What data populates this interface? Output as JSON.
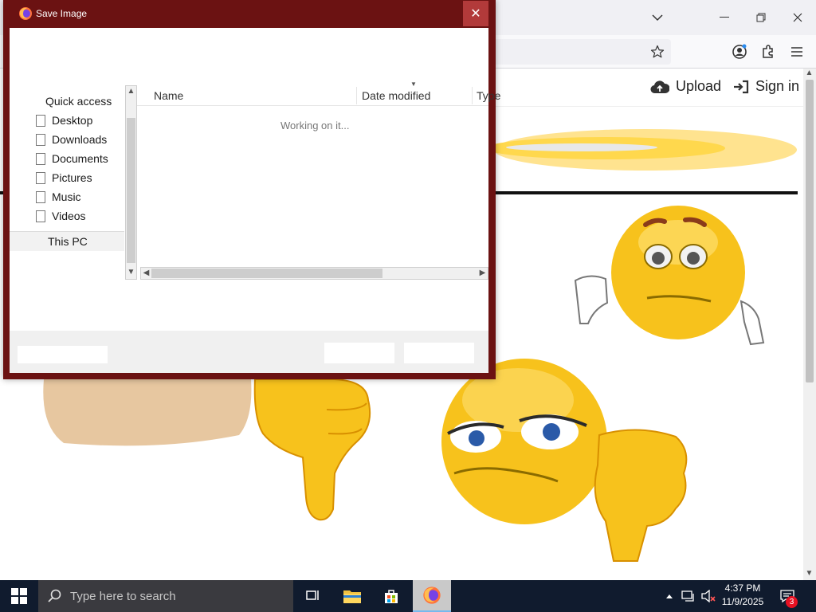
{
  "dialog": {
    "title": "Save Image",
    "close_glyph": "✕",
    "nav": {
      "quick_access": "Quick access",
      "items": [
        "Desktop",
        "Downloads",
        "Documents",
        "Pictures",
        "Music",
        "Videos"
      ],
      "this_pc": "This PC"
    },
    "columns": {
      "name": "Name",
      "date_modified": "Date modified",
      "type": "Type"
    },
    "status": "Working on it..."
  },
  "browser": {
    "header": {
      "upload": "Upload",
      "sign_in": "Sign in"
    }
  },
  "taskbar": {
    "search_placeholder": "Type here to search",
    "time": "4:37 PM",
    "date": "11/9/2025",
    "notification_count": "3"
  },
  "colors": {
    "dialog_frame": "#6b1212",
    "dialog_close": "#b23a3a",
    "taskbar": "#101b2e",
    "emoji_yellow": "#f7c21c"
  }
}
